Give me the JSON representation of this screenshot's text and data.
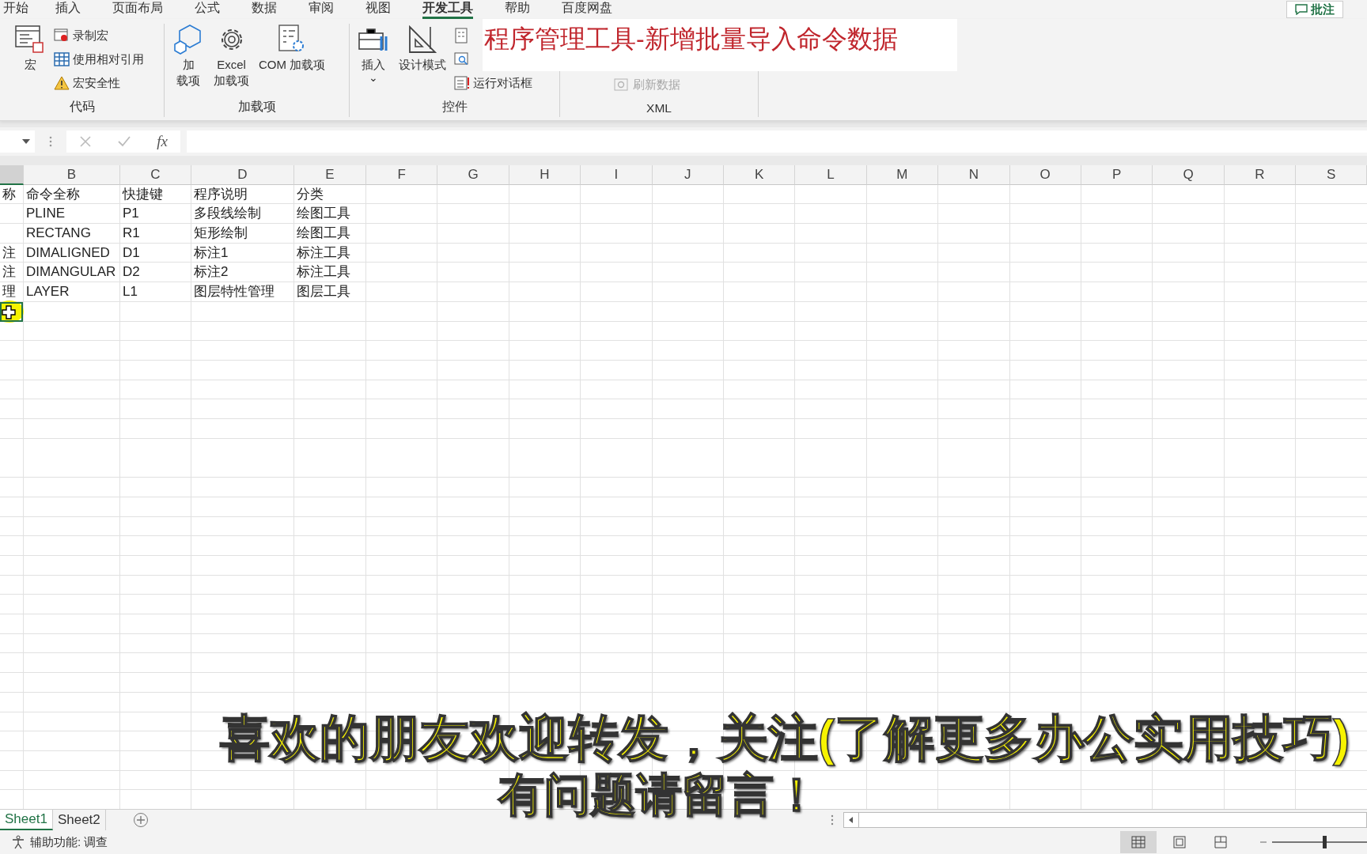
{
  "ribbon_tabs": [
    {
      "label": "开始",
      "selected": false
    },
    {
      "label": "插入",
      "selected": false
    },
    {
      "label": "页面布局",
      "selected": false
    },
    {
      "label": "公式",
      "selected": false
    },
    {
      "label": "数据",
      "selected": false
    },
    {
      "label": "审阅",
      "selected": false
    },
    {
      "label": "视图",
      "selected": false
    },
    {
      "label": "开发工具",
      "selected": true
    },
    {
      "label": "帮助",
      "selected": false
    },
    {
      "label": "百度网盘",
      "selected": false
    }
  ],
  "comment_button": "批注",
  "ribbon_groups": [
    {
      "label": "代码",
      "columns": [
        [
          {
            "kind": "large",
            "label": "宏",
            "disabled": false
          }
        ],
        [
          {
            "kind": "small",
            "label": "录制宏",
            "disabled": false
          },
          {
            "kind": "small",
            "label": "使用相对引用",
            "disabled": false
          },
          {
            "kind": "small",
            "label": "宏安全性",
            "disabled": false
          }
        ]
      ]
    },
    {
      "label": "加载项",
      "columns": [
        [
          {
            "kind": "large",
            "label_lines": [
              "加",
              "载项"
            ],
            "disabled": false
          }
        ],
        [
          {
            "kind": "large",
            "label_lines": [
              "Excel",
              "加载项"
            ],
            "disabled": false
          }
        ],
        [
          {
            "kind": "large",
            "label": "COM 加载项",
            "disabled": false
          }
        ]
      ]
    },
    {
      "label": "控件",
      "columns": [
        [
          {
            "kind": "large",
            "label": "插入",
            "caret": "⌄",
            "disabled": false
          }
        ],
        [
          {
            "kind": "large",
            "label": "设计模式",
            "disabled": false
          }
        ],
        [
          {
            "kind": "small",
            "disabled": false
          },
          {
            "kind": "small",
            "disabled": false
          },
          {
            "kind": "small",
            "label": "运行对话框",
            "disabled": false
          }
        ]
      ]
    },
    {
      "label": "XML",
      "columns": [
        [
          {
            "kind": "small",
            "label": "刷新数据",
            "disabled": true
          }
        ]
      ]
    }
  ],
  "overlay_title": "程序管理工具-新增批量导入命令数据",
  "formula_bar": {
    "function_label": "fx"
  },
  "columns": [
    "B",
    "C",
    "D",
    "E",
    "F",
    "G",
    "H",
    "I",
    "J",
    "K",
    "L",
    "M",
    "N",
    "O",
    "P",
    "Q",
    "R",
    "S"
  ],
  "rows": [
    [
      "称",
      "命令全称",
      "快捷键",
      "程序说明",
      "分类"
    ],
    [
      "",
      "PLINE",
      "P1",
      "多段线绘制",
      "绘图工具"
    ],
    [
      "",
      "RECTANG",
      "R1",
      "矩形绘制",
      "绘图工具"
    ],
    [
      "注",
      "DIMALIGNED",
      "D1",
      "标注1",
      "标注工具"
    ],
    [
      "注",
      "DIMANGULAR",
      "D2",
      "标注2",
      "标注工具"
    ],
    [
      "理",
      "LAYER",
      "L1",
      "图层特性管理",
      "图层工具"
    ]
  ],
  "sheet_tabs": [
    {
      "label": "Sheet1",
      "selected": true
    },
    {
      "label": "Sheet2",
      "selected": false
    }
  ],
  "status_text": "辅助功能: 调查",
  "zoom": {
    "level": 0.55
  },
  "caption_lines": [
    "喜欢的朋友欢迎转发，关注(了解更多办公实用技巧)",
    "有问题请留言！"
  ]
}
